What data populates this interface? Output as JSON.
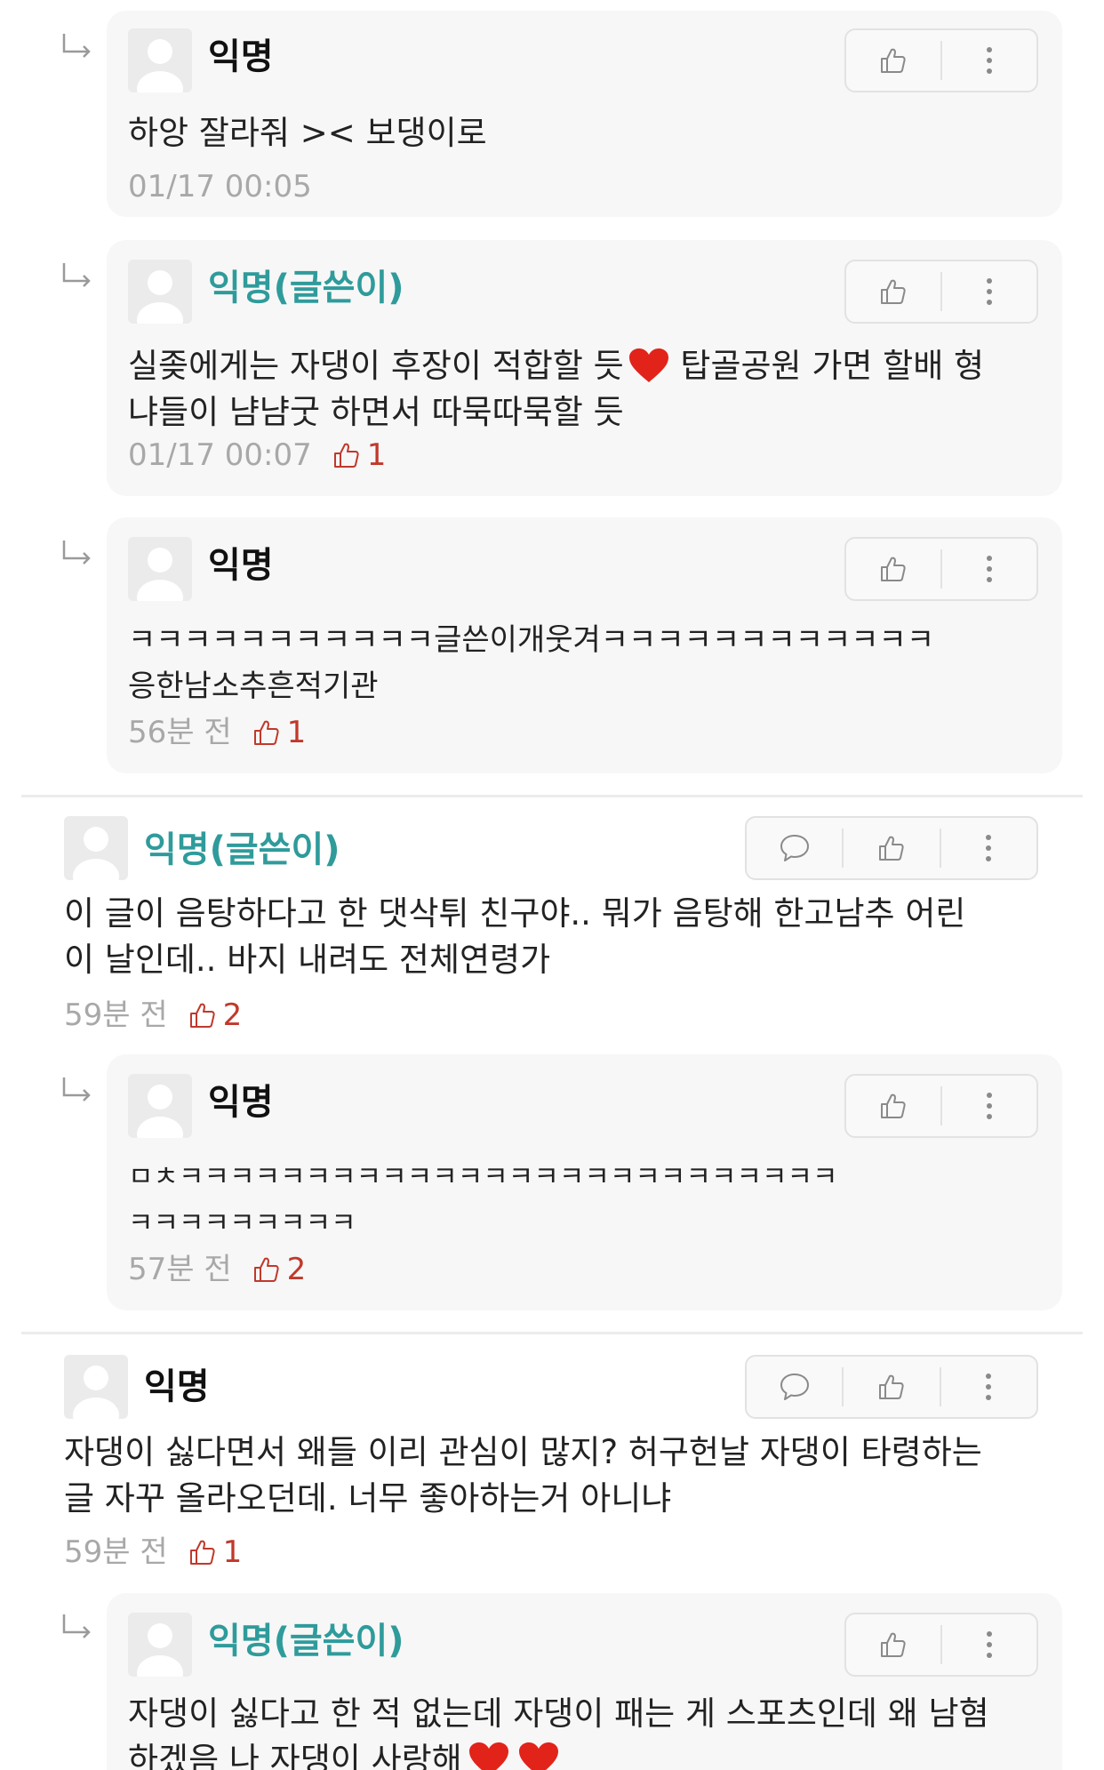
{
  "comments": [
    {
      "author": "익명",
      "lines": [
        "하앙 잘라줘 >< 보댕이로"
      ],
      "time": "01/17 00:05",
      "likes": ""
    },
    {
      "author": "익명(글쓴이)",
      "lines": [
        "실좆에게는 자댕이 후장이 적합할 듯",
        " 탑골공원 가면 할배 형",
        "냐들이 냠냠굿 하면서 따묵따묵할 듯"
      ],
      "time": "01/17 00:07",
      "likes": "1"
    },
    {
      "author": "익명",
      "lines": [
        "ㅋㅋㅋㅋㅋㅋㅋㅋㅋㅋㅋ글쓴이개웃겨ㅋㅋㅋㅋㅋㅋㅋㅋㅋㅋㅋㅋ",
        "응한남소추흔적기관"
      ],
      "time": "56분 전",
      "likes": "1"
    },
    {
      "author": "익명(글쓴이)",
      "lines": [
        "이 글이 음탕하다고 한 댓삭튀 친구야.. 뭐가 음탕해 한고남추 어린",
        "이 날인데.. 바지 내려도 전체연령가"
      ],
      "time": "59분 전",
      "likes": "2"
    },
    {
      "author": "익명",
      "lines": [
        "ㅁㅊㅋㅋㅋㅋㅋㅋㅋㅋㅋㅋㅋㅋㅋㅋㅋㅋㅋㅋㅋㅋㅋㅋㅋㅋㅋㅋ",
        "ㅋㅋㅋㅋㅋㅋㅋㅋㅋ"
      ],
      "time": "57분 전",
      "likes": "2"
    },
    {
      "author": "익명",
      "lines": [
        "자댕이 싫다면서 왜들 이리 관심이 많지? 허구헌날 자댕이 타령하는",
        "글 자꾸 올라오던데. 너무 좋아하는거 아니냐"
      ],
      "time": "59분 전",
      "likes": "1"
    },
    {
      "author": "익명(글쓴이)",
      "lines": [
        "자댕이 싫다고 한 적 없는데 자댕이 패는 게 스포츠인데 왜 남혐",
        "하겠음 나 자댕이 사랑해"
      ],
      "time": "",
      "likes": ""
    }
  ],
  "icons": {
    "reply": "reply-arrow-icon",
    "like": "thumbs-up-icon",
    "comment": "speech-bubble-icon",
    "more": "more-vertical-icon",
    "heart": "red-heart-icon"
  },
  "colors": {
    "op_author": "#2f9b9b",
    "like_count": "#c0392b",
    "card_bg": "#f7f7f7",
    "heart": "#e2231a"
  }
}
